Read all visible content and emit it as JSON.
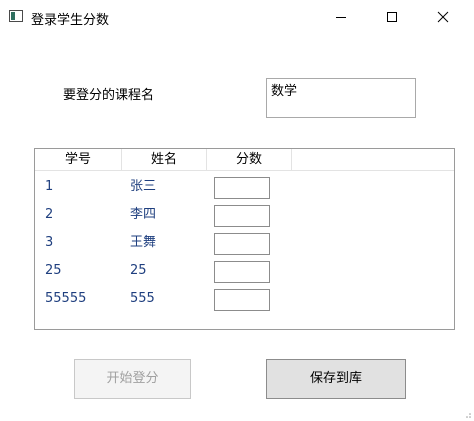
{
  "window": {
    "title": "登录学生分数",
    "icon": "app-window-icon"
  },
  "course": {
    "label": "要登分的课程名",
    "value": "数学"
  },
  "grid": {
    "columns": [
      "学号",
      "姓名",
      "分数"
    ],
    "rows": [
      {
        "id": "1",
        "name": "张三",
        "score": ""
      },
      {
        "id": "2",
        "name": "李四",
        "score": ""
      },
      {
        "id": "3",
        "name": "王舞",
        "score": ""
      },
      {
        "id": "25",
        "name": "25",
        "score": ""
      },
      {
        "id": "55555",
        "name": "555",
        "score": ""
      }
    ]
  },
  "buttons": {
    "start_label": "开始登分",
    "start_enabled": false,
    "save_label": "保存到库"
  },
  "colors": {
    "row_text": "#1f3f7f",
    "disabled_text": "#a0a0a0",
    "button_face": "#e1e1e1"
  }
}
